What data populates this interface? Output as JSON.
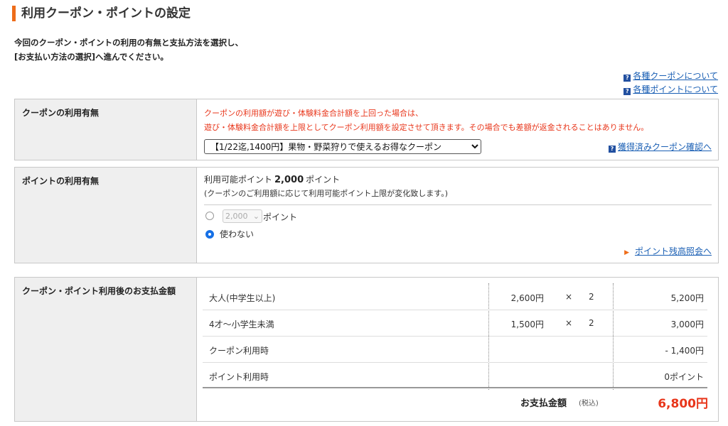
{
  "page": {
    "title": "利用クーポン・ポイントの設定",
    "intro_line1": "今回のクーポン・ポイントの利用の有無と支払方法を選択し、",
    "intro_line2": "[お支払い方法の選択]へ進んでください。",
    "link_coupon_info": "各種クーポンについて",
    "link_point_info": "各種ポイントについて"
  },
  "coupon": {
    "label": "クーポンの利用有無",
    "warning_line1": "クーポンの利用額が遊び・体験料金合計額を上回った場合は、",
    "warning_line2": "遊び・体験料金合計額を上限としてクーポン利用額を設定させて頂きます。その場合でも差額が返金されることはありません。",
    "selected": "【1/22迄,1400円】果物・野菜狩りで使えるお得なクーポン",
    "confirm_link": "獲得済みクーポン確認へ"
  },
  "points": {
    "label": "ポイントの利用有無",
    "available_prefix": "利用可能ポイント",
    "available_value": "2,000",
    "available_suffix": "ポイント",
    "note": "(クーポンのご利用額に応じて利用可能ポイント上限が変化致します。)",
    "select_value": "2,000",
    "unit": "ポイント",
    "no_use_label": "使わない",
    "selected_option": "使わない",
    "balance_link": "ポイント残高照会へ"
  },
  "payment": {
    "label": "クーポン・ポイント利用後のお支払金額",
    "rows": [
      {
        "name": "大人(中学生以上)",
        "price": "2,600円",
        "x": "×",
        "qty": "2",
        "amount": "5,200円"
      },
      {
        "name": "4才〜小学生未満",
        "price": "1,500円",
        "x": "×",
        "qty": "2",
        "amount": "3,000円"
      },
      {
        "name": "クーポン利用時",
        "price": "",
        "x": "",
        "qty": "",
        "amount": "- 1,400円"
      },
      {
        "name": "ポイント利用時",
        "price": "",
        "x": "",
        "qty": "",
        "amount": "0ポイント"
      }
    ],
    "total_label": "お支払金額",
    "total_tax": "(税込)",
    "total_amount": "6,800円"
  },
  "colors": {
    "accent": "#ee6d1a",
    "warning": "#e8361b",
    "link": "#1a5fb4"
  }
}
